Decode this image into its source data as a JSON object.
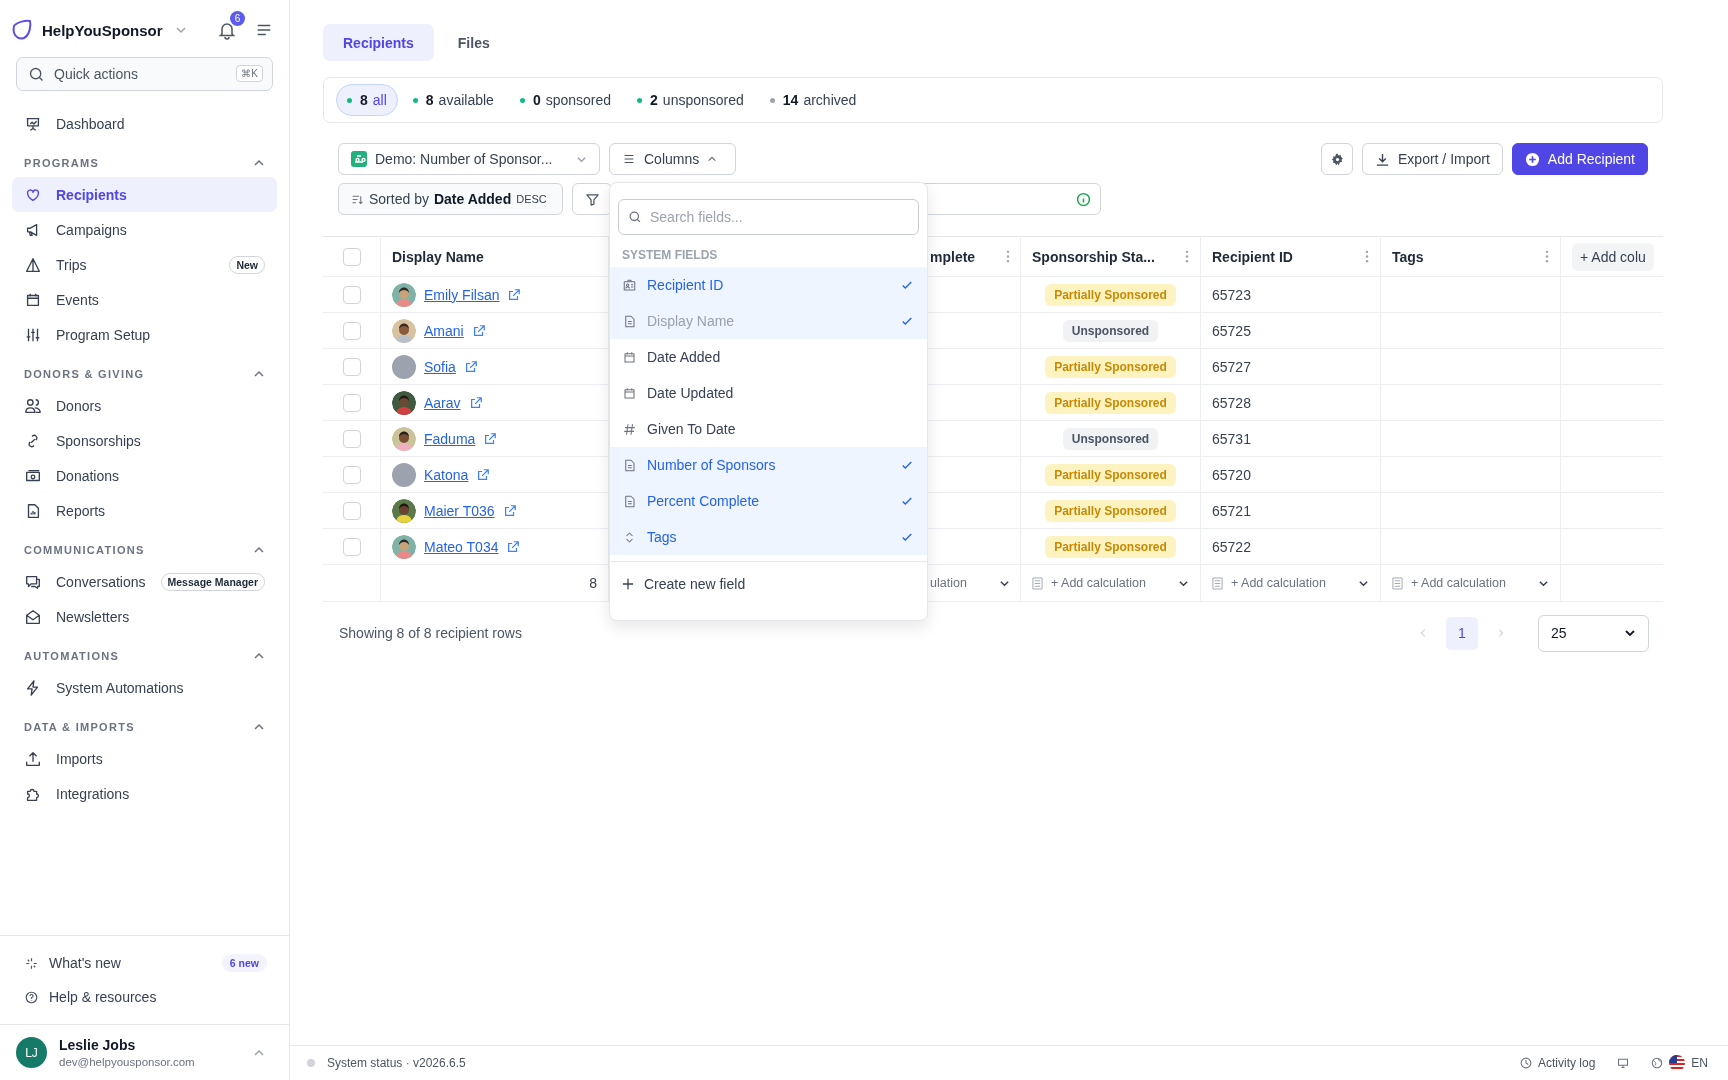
{
  "sidebar": {
    "brand": "HelpYouSponsor",
    "notifications": "6",
    "quick_actions": {
      "placeholder": "Quick actions",
      "shortcut": "⌘K"
    },
    "top_items": [
      {
        "label": "Dashboard",
        "selected": false
      }
    ],
    "sections": [
      {
        "title": "PROGRAMS",
        "expanded": true,
        "items": [
          {
            "label": "Recipients",
            "selected": true
          },
          {
            "label": "Campaigns",
            "selected": false
          },
          {
            "label": "Trips",
            "selected": false,
            "badge": "New"
          },
          {
            "label": "Events",
            "selected": false
          },
          {
            "label": "Program Setup",
            "selected": false
          }
        ]
      },
      {
        "title": "DONORS & GIVING",
        "expanded": true,
        "items": [
          {
            "label": "Donors",
            "selected": false
          },
          {
            "label": "Sponsorships",
            "selected": false
          },
          {
            "label": "Donations",
            "selected": false
          },
          {
            "label": "Reports",
            "selected": false
          }
        ]
      },
      {
        "title": "COMMUNICATIONS",
        "expanded": true,
        "items": [
          {
            "label": "Conversations",
            "selected": false,
            "badge": "Message Manager"
          },
          {
            "label": "Newsletters",
            "selected": false
          }
        ]
      },
      {
        "title": "AUTOMATIONS",
        "expanded": true,
        "items": [
          {
            "label": "System Automations",
            "selected": false
          }
        ]
      },
      {
        "title": "DATA & IMPORTS",
        "expanded": true,
        "items": [
          {
            "label": "Imports",
            "selected": false
          },
          {
            "label": "Integrations",
            "selected": false
          }
        ]
      }
    ],
    "footer_links": [
      {
        "label": "What's new",
        "badge": "6 new"
      },
      {
        "label": "Help & resources"
      }
    ],
    "user": {
      "initials": "LJ",
      "name": "Leslie Jobs",
      "email": "dev@helpyousponsor.com"
    }
  },
  "tabs": [
    {
      "label": "Recipients",
      "selected": true
    },
    {
      "label": "Files",
      "selected": false
    }
  ],
  "filters": [
    {
      "count": "8",
      "label": "all",
      "color": "#10b981",
      "selected": true
    },
    {
      "count": "8",
      "label": "available",
      "color": "#10b981",
      "selected": false
    },
    {
      "count": "0",
      "label": "sponsored",
      "color": "#10b981",
      "selected": false
    },
    {
      "count": "2",
      "label": "unsponsored",
      "color": "#10b981",
      "selected": false
    },
    {
      "count": "14",
      "label": "archived",
      "color": "#9ca3af",
      "selected": false
    }
  ],
  "toolbar": {
    "view": "Demo: Number of Sponsor...",
    "columns": {
      "label": "Columns",
      "expanded": true
    },
    "export": "Export / Import",
    "add": "Add Recipient"
  },
  "sort": {
    "prefix": "Sorted by",
    "field": "Date Added",
    "direction": "DESC"
  },
  "table": {
    "columns": [
      {
        "label": "Display Name"
      },
      {
        "label": "mplete"
      },
      {
        "label": "Sponsorship Sta..."
      },
      {
        "label": "Recipient ID"
      },
      {
        "label": "Tags"
      }
    ],
    "add_column": "+ Add colu",
    "all_checked": false,
    "rows": [
      {
        "name": "Emily Filsan",
        "checked": false,
        "status": {
          "text": "Partially Sponsored",
          "kind": "partial"
        },
        "recipient_id": "65723"
      },
      {
        "name": "Amani",
        "checked": false,
        "status": {
          "text": "Unsponsored",
          "kind": "unsponsored"
        },
        "recipient_id": "65725"
      },
      {
        "name": "Sofia",
        "checked": false,
        "avatar": {
          "kind": "placeholder"
        },
        "status": {
          "text": "Partially Sponsored",
          "kind": "partial"
        },
        "recipient_id": "65727"
      },
      {
        "name": "Aarav",
        "checked": false,
        "status": {
          "text": "Partially Sponsored",
          "kind": "partial"
        },
        "recipient_id": "65728"
      },
      {
        "name": "Faduma",
        "checked": false,
        "status": {
          "text": "Unsponsored",
          "kind": "unsponsored"
        },
        "recipient_id": "65731"
      },
      {
        "name": "Katona",
        "checked": false,
        "avatar": {
          "kind": "placeholder"
        },
        "status": {
          "text": "Partially Sponsored",
          "kind": "partial"
        },
        "recipient_id": "65720"
      },
      {
        "name": "Maier T036",
        "checked": false,
        "status": {
          "text": "Partially Sponsored",
          "kind": "partial"
        },
        "recipient_id": "65721"
      },
      {
        "name": "Mateo T034",
        "checked": false,
        "status": {
          "text": "Partially Sponsored",
          "kind": "partial"
        },
        "recipient_id": "65722"
      }
    ],
    "footer": {
      "count": "8",
      "cut_calculation": "ulation",
      "calculations": [
        "+ Add calculation",
        "+ Add calculation",
        "+ Add calculation"
      ]
    }
  },
  "summary": "Showing 8 of 8 recipient rows",
  "pagination": {
    "pages": [
      {
        "label": "1",
        "selected": true
      }
    ],
    "per_page": "25"
  },
  "columns_menu": {
    "placeholder": "Search fields...",
    "section": "SYSTEM FIELDS",
    "items": [
      {
        "label": "Recipient ID",
        "kind": "id",
        "checked": true,
        "disabled": false
      },
      {
        "label": "Display Name",
        "kind": "text",
        "checked": true,
        "disabled": true
      },
      {
        "label": "Date Added",
        "kind": "date",
        "checked": false,
        "disabled": false
      },
      {
        "label": "Date Updated",
        "kind": "date",
        "checked": false,
        "disabled": false
      },
      {
        "label": "Given To Date",
        "kind": "number",
        "checked": false,
        "disabled": false
      },
      {
        "label": "Number of Sponsors",
        "kind": "text",
        "checked": true,
        "disabled": false
      },
      {
        "label": "Percent Complete",
        "kind": "text",
        "checked": true,
        "disabled": false
      },
      {
        "label": "Tags",
        "kind": "select",
        "checked": true,
        "disabled": false
      }
    ],
    "create": "Create new field"
  },
  "status_bar": {
    "status": "System status · v2026.6.5",
    "activity": "Activity log",
    "language": "EN"
  }
}
